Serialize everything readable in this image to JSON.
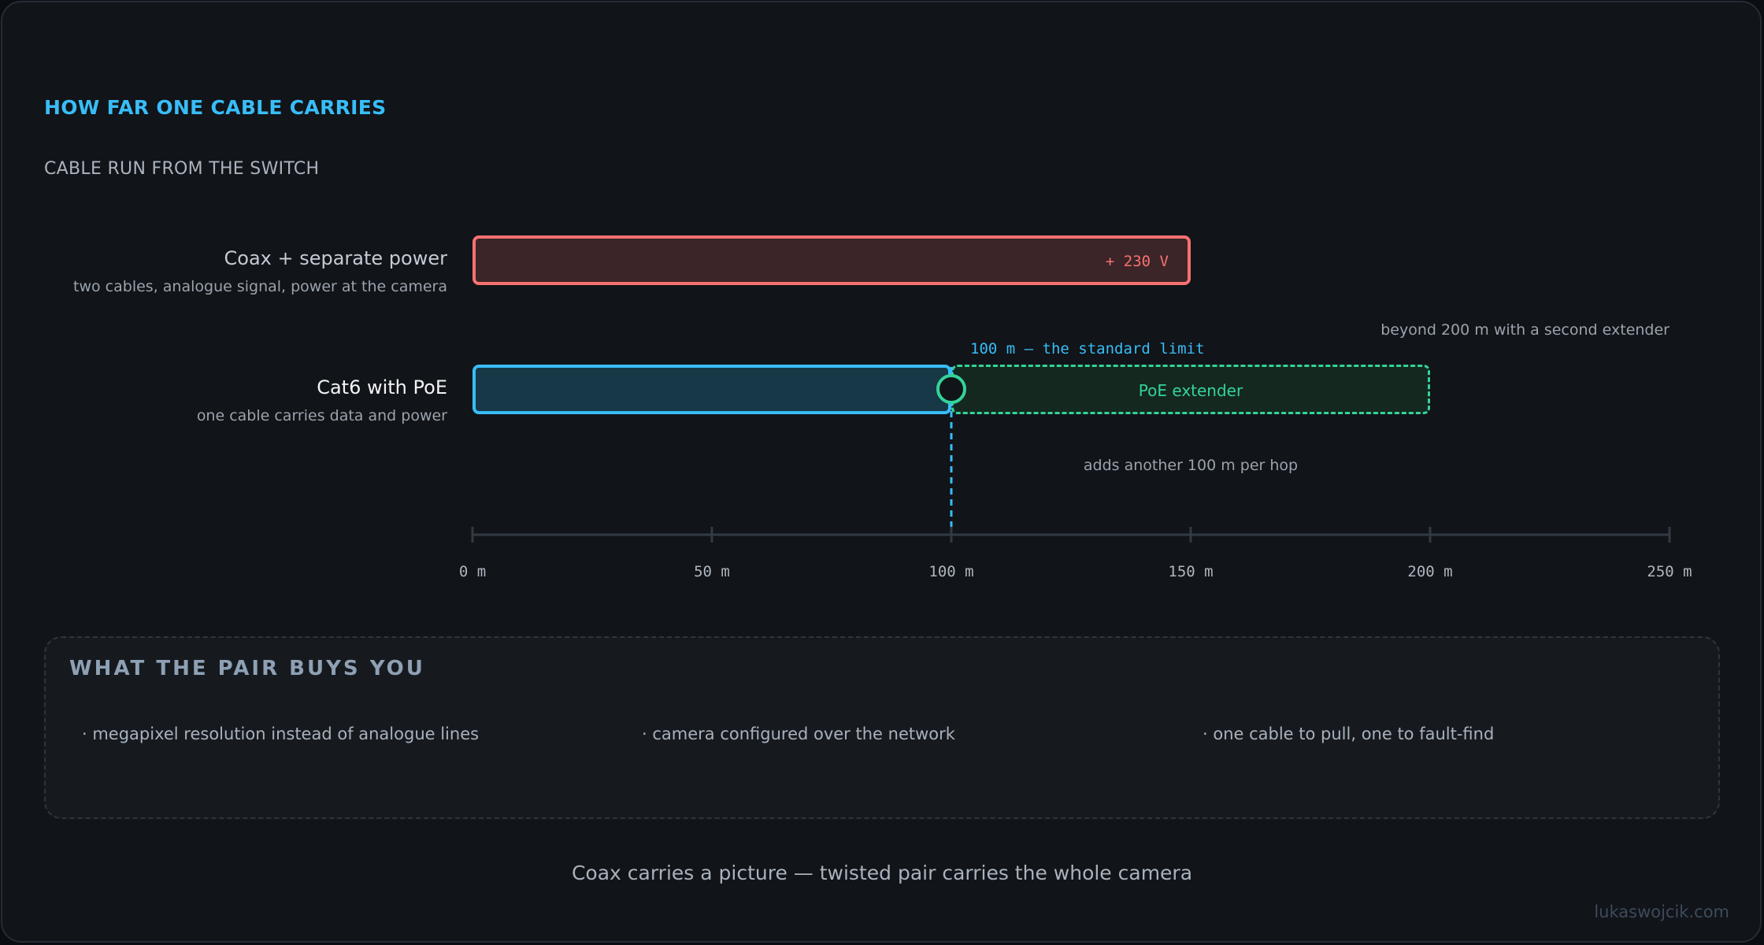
{
  "title": "HOW FAR ONE CABLE CARRIES",
  "section_label": "CABLE RUN FROM THE SWITCH",
  "rows": [
    {
      "name": "Coax + separate power",
      "description": "two cables, analogue signal, power at the camera",
      "bar_label": "+ 230 V",
      "length_m": 150,
      "color": "#f87171"
    },
    {
      "name": "Cat6 with PoE",
      "description": "one cable carries data and power",
      "length_m": 100,
      "color": "#38bdf8"
    }
  ],
  "extender": {
    "label": "PoE extender",
    "from_m": 100,
    "to_m": 200,
    "note_above": "beyond 200 m with a second extender",
    "note_below": "adds another 100 m per hop",
    "color": "#34d399"
  },
  "limit": {
    "value_m": 100,
    "label": "100 m — the standard limit"
  },
  "axis": {
    "min_m": 0,
    "max_m": 250,
    "ticks": [
      "0 m",
      "50 m",
      "100 m",
      "150 m",
      "200 m",
      "250 m"
    ]
  },
  "benefits": {
    "title": "WHAT THE PAIR BUYS YOU",
    "items": [
      "· megapixel resolution instead of analogue lines",
      "· camera configured over the network",
      "· one cable to pull, one to fault-find"
    ]
  },
  "caption": "Coax carries a picture — twisted pair carries the whole camera",
  "credit": "lukaswojcik.com"
}
